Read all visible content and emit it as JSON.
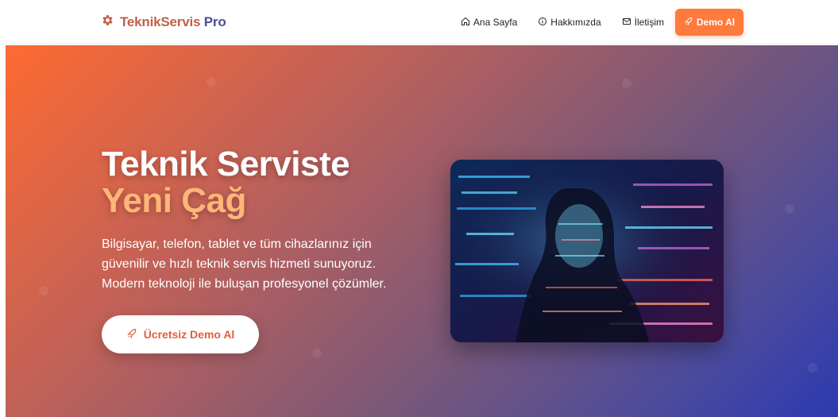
{
  "brand": {
    "name_a": "TeknikServis",
    "name_b": " Pro",
    "icon": "gear-icon",
    "color_a": "#c0604a",
    "color_b": "#4a4e9a"
  },
  "nav": {
    "items": [
      {
        "label": "Ana Sayfa",
        "icon": "home-icon"
      },
      {
        "label": "Hakkımızda",
        "icon": "info-icon"
      },
      {
        "label": "İletişim",
        "icon": "mail-icon"
      }
    ],
    "demo_label": "Demo Al",
    "demo_icon": "rocket-icon",
    "accent_color": "#ff7a3d"
  },
  "hero": {
    "title_line1": "Teknik Serviste",
    "title_line2": "Yeni Çağ",
    "description": "Bilgisayar, telefon, tablet ve tüm cihazlarınız için güvenilir ve hızlı teknik servis hizmeti sunuyoruz. Modern teknoloji ile buluşan profesyonel çözümler.",
    "cta_label": "Ücretsiz Demo Al",
    "cta_icon": "rocket-icon",
    "image_subject": "woman-with-code-projection-image"
  }
}
